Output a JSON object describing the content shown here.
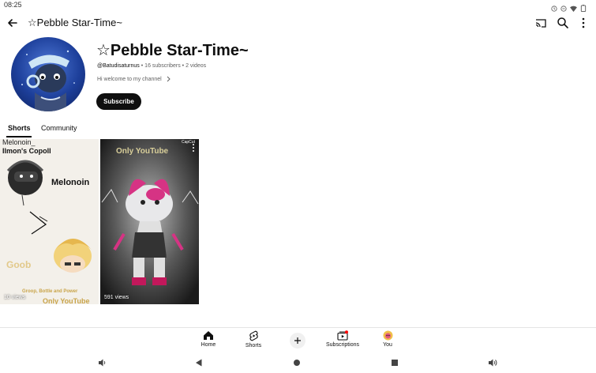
{
  "status_bar": {
    "time": "08:25"
  },
  "top_bar": {
    "title": "☆Pebble Star-Time~"
  },
  "channel": {
    "name": "☆Pebble Star-Time~",
    "handle": "@Batudisaturnus",
    "subscribers": "16 subscribers",
    "videos": "2 videos",
    "separator": "•",
    "description": "Hi welcome to my channel",
    "subscribe_label": "Subscribe"
  },
  "tabs": [
    {
      "label": "Shorts",
      "active": true
    },
    {
      "label": "Community",
      "active": false
    }
  ],
  "shorts": [
    {
      "views": "10 views",
      "overlay_text": [
        "Melonoin_",
        "Ilmon's Copoll",
        "Melonoin",
        "Goob",
        "Groop, Bottle and Power",
        "Only YouTube"
      ]
    },
    {
      "views": "591 views",
      "overlay_text": [
        "Only YouTube",
        "CapCut"
      ]
    }
  ],
  "bottom_nav": [
    {
      "label": "Home",
      "icon": "home-icon"
    },
    {
      "label": "Shorts",
      "icon": "shorts-icon"
    },
    {
      "label": "Subscriptions",
      "icon": "subscriptions-icon"
    },
    {
      "label": "You",
      "icon": "you-avatar-icon"
    }
  ],
  "colors": {
    "text_primary": "#0f0f0f",
    "text_secondary": "#606060",
    "subscribe_bg": "#0f0f0f",
    "notification_dot": "#ff0000"
  }
}
